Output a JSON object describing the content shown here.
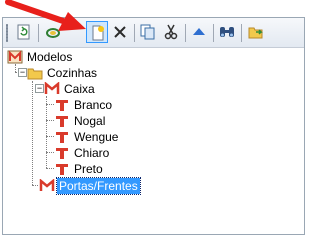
{
  "toolbar": {
    "buttons": [
      {
        "icon": "refresh-icon"
      },
      {
        "icon": "link-icon"
      },
      {
        "icon": "new-document-icon",
        "active": true
      },
      {
        "icon": "delete-icon"
      },
      {
        "icon": "copy-icon"
      },
      {
        "icon": "cut-icon"
      },
      {
        "icon": "move-up-icon"
      },
      {
        "icon": "find-icon"
      },
      {
        "icon": "open-folder-icon"
      }
    ]
  },
  "tree": {
    "root": {
      "label": "Modelos",
      "icon": "models-icon"
    },
    "folder": {
      "label": "Cozinhas",
      "expander": "−",
      "icon": "folder-icon"
    },
    "module": {
      "label": "Caixa",
      "expander": "−",
      "icon": "module-icon"
    },
    "materials": [
      {
        "label": "Branco"
      },
      {
        "label": "Nogal"
      },
      {
        "label": "Wengue"
      },
      {
        "label": "Chiaro"
      },
      {
        "label": "Preto"
      }
    ],
    "selected_module": {
      "label": "Portas/Frentes",
      "icon": "module-icon"
    }
  },
  "colors": {
    "selection": "#3399ff",
    "annotation_arrow": "#e8201b",
    "material_icon": "#d93a2b",
    "folder": "#f2c94c"
  }
}
